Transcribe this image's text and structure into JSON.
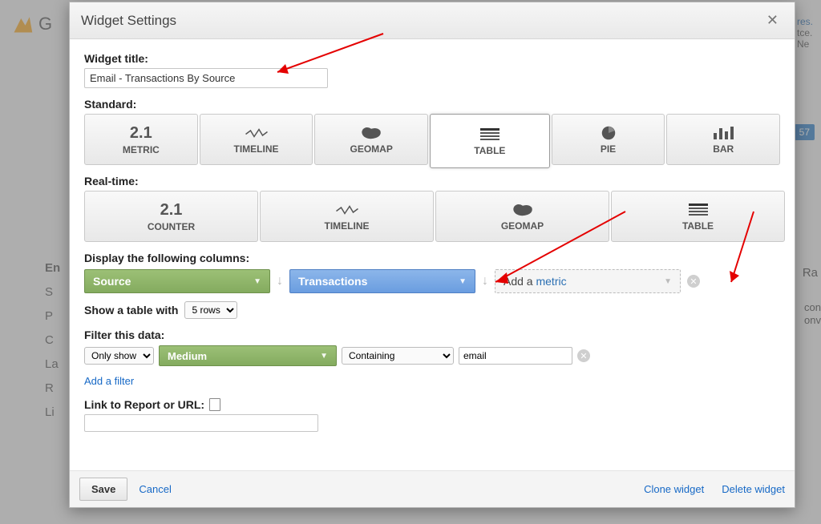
{
  "ga_brand_initial": "G",
  "bg_sidebar": {
    "heading": "En",
    "items": [
      "S",
      "P",
      "C",
      "La",
      "R",
      "Li"
    ]
  },
  "bg_right_text1": "res.",
  "bg_right_text2": "tce.",
  "bg_right_text3": "Ne",
  "bg_right_badge": "57",
  "bg_right_ra": "Ra",
  "bg_right_con": "con",
  "bg_right_onv": "onv",
  "modal": {
    "title": "Widget Settings",
    "title_label": "Widget title:",
    "title_value": "Email - Transactions By Source",
    "standard_label": "Standard:",
    "realtime_label": "Real-time:",
    "standard_tiles": [
      {
        "num": "2.1",
        "label": "METRIC"
      },
      {
        "label": "TIMELINE"
      },
      {
        "label": "GEOMAP"
      },
      {
        "label": "TABLE"
      },
      {
        "label": "PIE"
      },
      {
        "label": "BAR"
      }
    ],
    "realtime_tiles": [
      {
        "num": "2.1",
        "label": "COUNTER"
      },
      {
        "label": "TIMELINE"
      },
      {
        "label": "GEOMAP"
      },
      {
        "label": "TABLE"
      }
    ],
    "cols_label": "Display the following columns:",
    "col1": "Source",
    "col2": "Transactions",
    "addmetric_prefix": "Add a ",
    "addmetric_word": "metric",
    "show_table_label": "Show a table with",
    "row_options": [
      "5 rows"
    ],
    "row_selected": "5 rows",
    "filter_label": "Filter this data:",
    "filter_mode": "Only show",
    "filter_dim": "Medium",
    "filter_match": "Containing",
    "filter_value": "email",
    "add_filter": "Add a filter",
    "link_label": "Link to Report or URL:",
    "save": "Save",
    "cancel": "Cancel",
    "clone": "Clone widget",
    "delete": "Delete widget"
  }
}
